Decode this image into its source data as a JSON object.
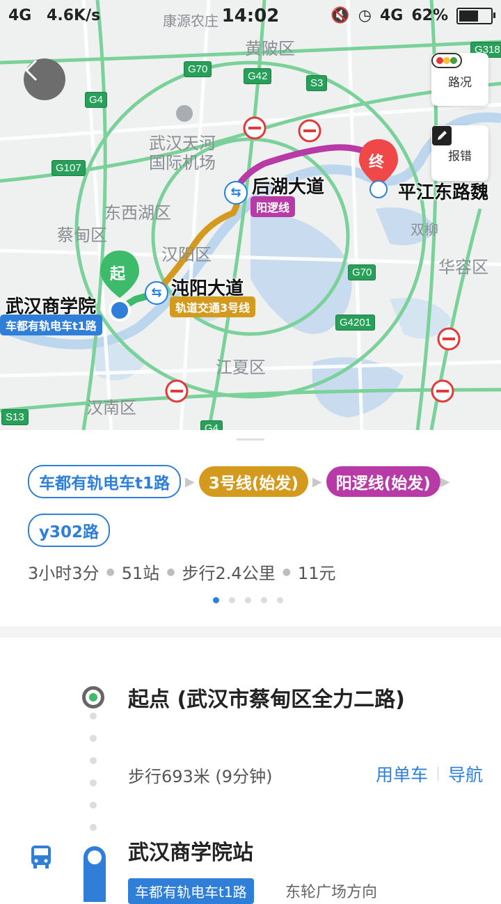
{
  "status_bar": {
    "network": "4G",
    "speed": "4.6K/s",
    "time": "14:02",
    "signal": "4G",
    "battery": "62%",
    "battery_level": 0.62
  },
  "map": {
    "labels": [
      "黄陂区",
      "武汉天河",
      "国际机场",
      "东西湖区",
      "蔡甸区",
      "汉阳区",
      "江夏区",
      "汉南区",
      "华容区",
      "双柳",
      "康源农庄"
    ],
    "roads": [
      "G70",
      "G42",
      "S3",
      "G4",
      "G107",
      "G70",
      "G4201",
      "S13",
      "G4",
      "G318"
    ],
    "traffic_button": "路况",
    "report_button": "报错",
    "start_marker": "起",
    "end_marker": "终",
    "stops": {
      "start_stop": "武汉商学院",
      "start_line": "车都有轨电车t1路",
      "transfer1_stop": "沌阳大道",
      "transfer1_line": "轨道交通3号线",
      "transfer2_stop": "后湖大道",
      "transfer2_line": "阳逻线",
      "end_stop": "平江东路魏"
    }
  },
  "route": {
    "chips": [
      {
        "label": "车都有轨电车t1路",
        "style": "outline"
      },
      {
        "label": "3号线(始发)",
        "style": "line3"
      },
      {
        "label": "阳逻线(始发)",
        "style": "yangluo"
      },
      {
        "label": "y302路",
        "style": "outline"
      }
    ],
    "summary": {
      "duration": "3小时3分",
      "stations": "51站",
      "walk": "步行2.4公里",
      "price": "11元"
    },
    "pages": 5,
    "active_page": 1
  },
  "detail": {
    "start": "起点 (武汉市蔡甸区全力二路)",
    "walk": "步行693米 (9分钟)",
    "bike_action": "用单车",
    "nav_action": "导航",
    "station": "武汉商学院站",
    "bus_line": "车都有轨电车t1路",
    "direction": "东轮广场方向"
  },
  "colors": {
    "accent": "#2f7fd8",
    "line3": "#d49a1e",
    "yangluo": "#b73aa6",
    "walk_green": "#3dbb6a"
  }
}
